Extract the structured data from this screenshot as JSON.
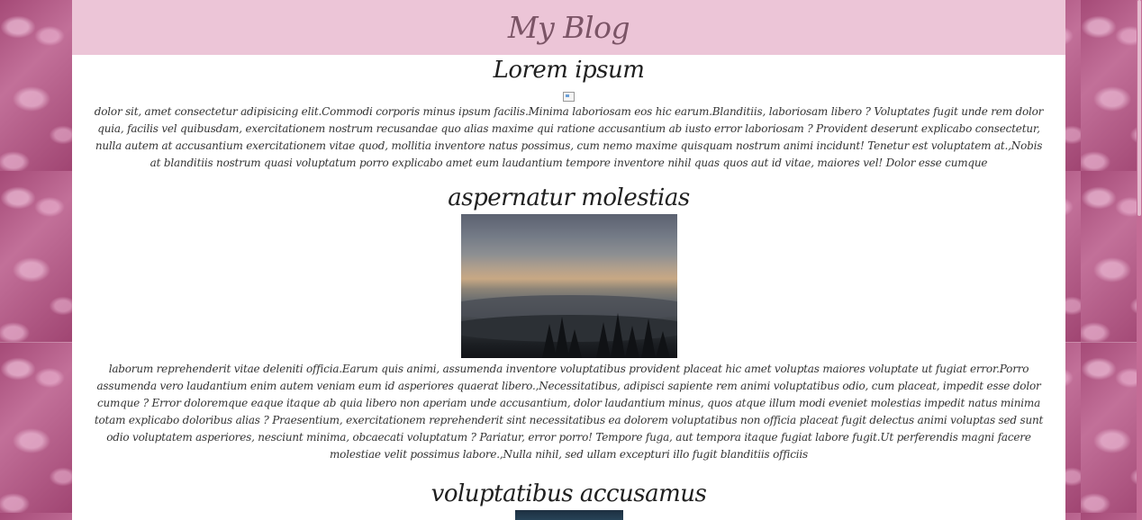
{
  "blog": {
    "title": "My Blog"
  },
  "posts": [
    {
      "title": "Lorem ipsum",
      "image": "broken-image-icon",
      "body": "dolor sit, amet consectetur adipisicing elit.Commodi corporis minus ipsum facilis.Minima laboriosam eos hic earum.Blanditiis, laboriosam libero ? Voluptates fugit unde rem dolor quia, facilis vel quibusdam, exercitationem nostrum recusandae quo alias maxime qui ratione accusantium ab iusto error laboriosam ? Provident deserunt explicabo consectetur, nulla autem at accusantium exercitationem vitae quod, mollitia inventore natus possimus, cum nemo maxime quisquam nostrum animi incidunt! Tenetur est voluptatem at.,Nobis at blanditiis nostrum quasi voluptatum porro explicabo amet eum laudantium tempore inventore nihil quas quos aut id vitae, maiores vel! Dolor esse cumque"
    },
    {
      "title": "aspernatur molestias",
      "image": "misty-landscape-photo",
      "body": "laborum reprehenderit vitae deleniti officia.Earum quis animi, assumenda inventore voluptatibus provident placeat hic amet voluptas maiores voluptate ut fugiat error.Porro assumenda vero laudantium enim autem veniam eum id asperiores quaerat libero.,Necessitatibus, adipisci sapiente rem animi voluptatibus odio, cum placeat, impedit esse dolor cumque ? Error doloremque eaque itaque ab quia libero non aperiam unde accusantium, dolor laudantium minus, quos atque illum modi eveniet molestias impedit natus minima totam explicabo doloribus alias ? Praesentium, exercitationem reprehenderit sint necessitatibus ea dolorem voluptatibus non officia placeat fugit delectus animi voluptas sed sunt odio voluptatem asperiores, nesciunt minima, obcaecati voluptatum ? Pariatur, error porro! Tempore fuga, aut tempora itaque fugiat labore fugit.Ut perferendis magni facere molestiae velit possimus labore.,Nulla nihil, sed ullam excepturi illo fugit blanditiis officiis"
    },
    {
      "title": "voluptatibus accusamus",
      "image": "night-landscape-photo"
    }
  ],
  "colors": {
    "header_bg": "#ecc5d7",
    "header_text": "#7b5466",
    "page_bg": "#ffffff",
    "side_bg": "#b8628c"
  }
}
